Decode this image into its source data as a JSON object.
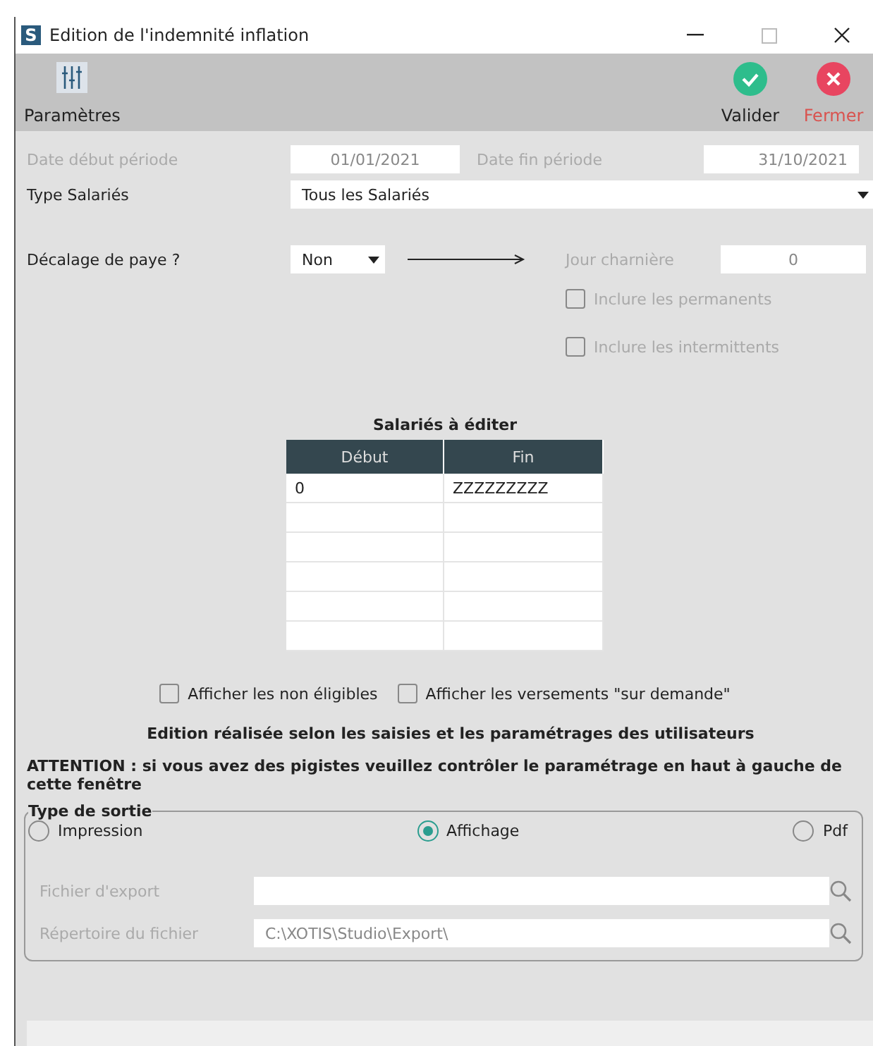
{
  "window": {
    "title": "Edition de l'indemnité inflation",
    "icon_letter": "S"
  },
  "toolbar": {
    "left": [
      {
        "label": "Paramètres",
        "kind": "settings"
      }
    ],
    "right": [
      {
        "label": "Valider",
        "kind": "ok"
      },
      {
        "label": "Fermer",
        "kind": "close"
      }
    ]
  },
  "period": {
    "start_label": "Date début période",
    "start_value": "01/01/2021",
    "end_label": "Date fin période",
    "end_value": "31/10/2021",
    "disabled": true
  },
  "type_salaries": {
    "label": "Type Salariés",
    "value": "Tous les Salariés"
  },
  "decalage": {
    "label": "Décalage de paye ?",
    "value": "Non",
    "pivot_label": "Jour charnière",
    "pivot_value": "0",
    "disabled": true
  },
  "include_options": [
    {
      "label": "Inclure les permanents",
      "checked": false,
      "disabled": true
    },
    {
      "label": "Inclure les intermittents",
      "checked": false,
      "disabled": true
    }
  ],
  "salaries_table": {
    "title": "Salariés à éditer",
    "columns": [
      "Début",
      "Fin"
    ],
    "rows": [
      [
        "0",
        "ZZZZZZZZZ"
      ],
      [
        "",
        ""
      ],
      [
        "",
        ""
      ],
      [
        "",
        ""
      ],
      [
        "",
        ""
      ],
      [
        "",
        ""
      ]
    ]
  },
  "display_options": [
    {
      "label": "Afficher les non éligibles",
      "checked": false
    },
    {
      "label": "Afficher les versements \"sur demande\"",
      "checked": false
    }
  ],
  "note": "Edition réalisée selon les saisies et les paramétrages des utilisateurs",
  "warning": "ATTENTION : si vous avez des pigistes veuillez contrôler le paramétrage en haut à gauche de cette fenêtre",
  "output": {
    "legend": "Type de sortie",
    "options": [
      {
        "label": "Impression",
        "selected": false
      },
      {
        "label": "Affichage",
        "selected": true
      },
      {
        "label": "Pdf",
        "selected": false
      }
    ],
    "fields": [
      {
        "label": "Fichier d'export",
        "disabled": true
      },
      {
        "label": "Répertoire du fichier",
        "value": "C:\\XOTIS\\Studio\\Export\\",
        "disabled": true
      }
    ]
  }
}
